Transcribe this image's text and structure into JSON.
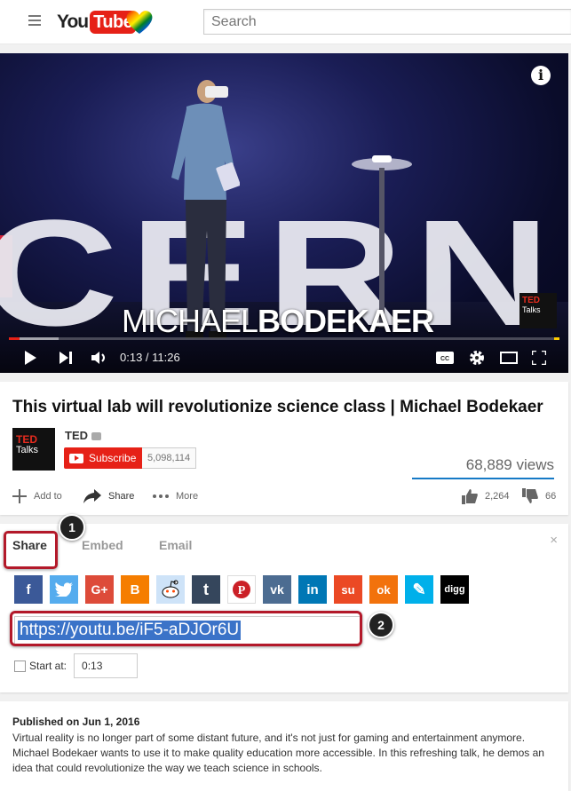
{
  "header": {
    "logo_you": "You",
    "logo_tube": "Tube",
    "search_placeholder": "Search"
  },
  "player": {
    "overlay_first": "MICHAEL",
    "overlay_last": "BODEKAER",
    "stage_text": "CERN",
    "corner_logo_ted": "TED",
    "corner_logo_talks": "Talks",
    "info_icon": "i",
    "time": "0:13 / 11:26",
    "progress_fraction": 0.019,
    "buffer_fraction": 0.09,
    "colors": {
      "progress": "#e62117",
      "accent": "#ffcc00"
    }
  },
  "video": {
    "title": "This virtual lab will revolutionize science class | Michael Bodekaer",
    "channel": "TED",
    "channel_thumb_ted": "TED",
    "channel_thumb_talks": "Talks",
    "subscribe_label": "Subscribe",
    "subscriber_count": "5,098,114",
    "views": "68,889 views",
    "actions": {
      "add_to": "Add to",
      "share": "Share",
      "more": "More",
      "likes": "2,264",
      "dislikes": "66"
    }
  },
  "share": {
    "tabs": [
      "Share",
      "Embed",
      "Email"
    ],
    "close": "×",
    "social": [
      {
        "name": "facebook",
        "glyph": "f",
        "color": "#3b5998"
      },
      {
        "name": "twitter",
        "glyph": "t",
        "color": "#55acee"
      },
      {
        "name": "google-plus",
        "glyph": "G+",
        "color": "#dd4b39"
      },
      {
        "name": "blogger",
        "glyph": "B",
        "color": "#f57d00"
      },
      {
        "name": "reddit",
        "glyph": "r",
        "color": "#cee3f8"
      },
      {
        "name": "tumblr",
        "glyph": "t",
        "color": "#35465c"
      },
      {
        "name": "pinterest",
        "glyph": "P",
        "color": "#cb2027"
      },
      {
        "name": "vk",
        "glyph": "vk",
        "color": "#4c6c91"
      },
      {
        "name": "linkedin",
        "glyph": "in",
        "color": "#0077b5"
      },
      {
        "name": "stumbleupon",
        "glyph": "su",
        "color": "#eb4924"
      },
      {
        "name": "odnoklassniki",
        "glyph": "ok",
        "color": "#f2720c"
      },
      {
        "name": "livejournal",
        "glyph": "✎",
        "color": "#00b0ea"
      },
      {
        "name": "digg",
        "glyph": "digg",
        "color": "#000000"
      }
    ],
    "url": "https://youtu.be/iF5-aDJOr6U",
    "start_at_label": "Start at:",
    "start_at_value": "0:13"
  },
  "callouts": [
    "1",
    "2"
  ],
  "description": {
    "published": "Published on Jun 1, 2016",
    "text": "Virtual reality is no longer part of some distant future, and it's not just for gaming and entertainment anymore. Michael Bodekaer wants to use it to make quality education more accessible. In this refreshing talk, he demos an idea that could revolutionize the way we teach science in schools."
  }
}
